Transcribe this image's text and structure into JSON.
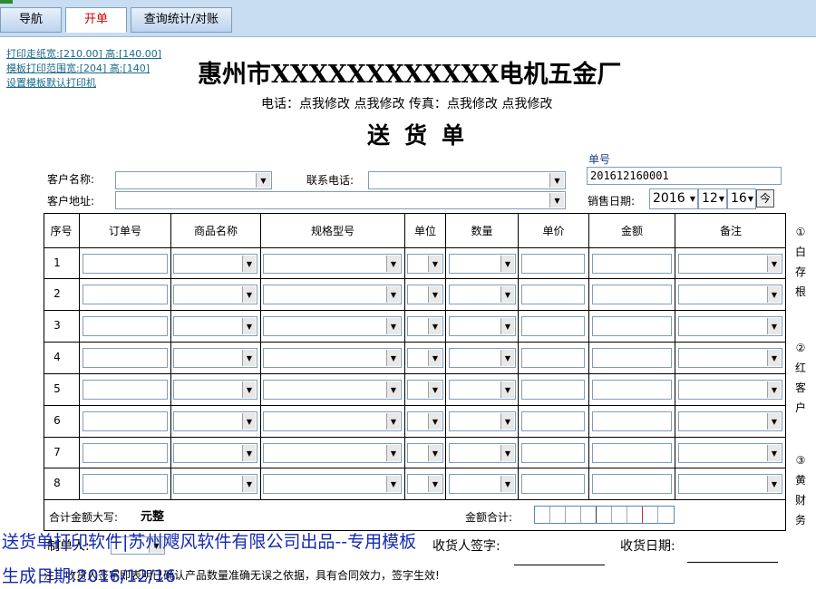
{
  "tabs": [
    {
      "label": "导航"
    },
    {
      "label": "开单"
    },
    {
      "label": "查询统计/对账"
    }
  ],
  "print_links": {
    "paper": "打印走纸宽:[210.00] 高:[140.00]",
    "range": "模板打印范围宽:[204] 高:[140]",
    "printer": "设置模板默认打印机"
  },
  "header": {
    "company": "惠州市XXXXXXXXXXXX电机五金厂",
    "contact": "电话：点我修改 点我修改  传真：点我修改 点我修改",
    "doc_title": "送货单"
  },
  "form": {
    "customer_name_label": "客户名称:",
    "phone_label": "联系电话:",
    "address_label": "客户地址:",
    "order_no_label": "单号",
    "order_no_value": "201612160001",
    "sale_date_label": "销售日期:",
    "date_year": "2016",
    "date_month": "12",
    "date_day": "16",
    "today_button": "今"
  },
  "table": {
    "columns": [
      "序号",
      "订单号",
      "商品名称",
      "规格型号",
      "单位",
      "数量",
      "单价",
      "金额",
      "备注"
    ],
    "rows": [
      "1",
      "2",
      "3",
      "4",
      "5",
      "6",
      "7",
      "8"
    ]
  },
  "side_notes": [
    {
      "lines": [
        "①",
        "白",
        "存",
        "根"
      ]
    },
    {
      "lines": [
        "②",
        "红",
        "客",
        "户"
      ]
    },
    {
      "lines": [
        "③",
        "黄",
        "财",
        "务"
      ]
    }
  ],
  "footer": {
    "amount_words_label": "合计金额大写:",
    "amount_words_value": "元整",
    "amount_total_label": "金额合计:",
    "maker_label": "制单人:",
    "receiver_label": "收货人签字:",
    "receive_date_label": "收货日期:",
    "note": "注：收货人签字即表明已确认产品数量准确无误之依据，具有合同效力，签字生效!"
  },
  "watermark": {
    "line1": "送货单打印软件|苏州飕风软件有限公司出品--专用模板",
    "line2": "生成日期:2016/12/16"
  }
}
